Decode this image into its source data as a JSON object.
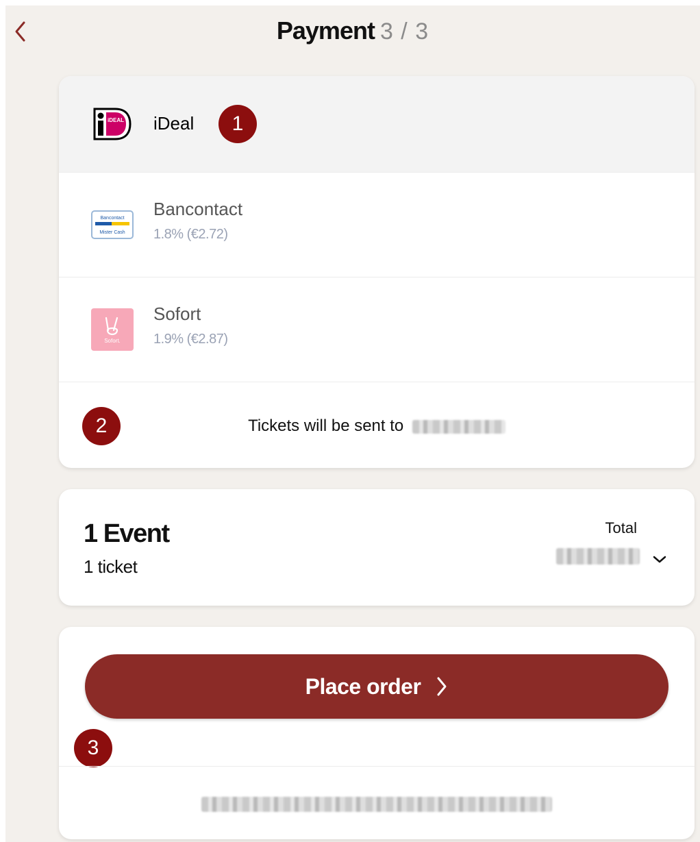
{
  "header": {
    "title": "Payment",
    "step": "3 / 3",
    "back_icon": "chevron-left-icon"
  },
  "payment_methods": [
    {
      "name": "iDeal",
      "fee": "",
      "icon": "ideal-logo-icon",
      "selected": true
    },
    {
      "name": "Bancontact",
      "fee": "1.8% (€2.72)",
      "icon": "bancontact-logo-icon",
      "selected": false
    },
    {
      "name": "Sofort",
      "fee": "1.9% (€2.87)",
      "icon": "sofort-logo-icon",
      "selected": false
    }
  ],
  "tickets_notice": "Tickets will be sent to",
  "summary": {
    "events": "1 Event",
    "tickets": "1 ticket",
    "total_label": "Total"
  },
  "order": {
    "button_label": "Place order"
  },
  "annotations": [
    "1",
    "2",
    "3"
  ],
  "colors": {
    "accent": "#8b2b27",
    "badge": "#8c0e0e",
    "ideal": "#cc0066",
    "sofort": "#f7a8b8",
    "bancontact_blue": "#1e5aa8",
    "bancontact_yellow": "#f6c400"
  }
}
